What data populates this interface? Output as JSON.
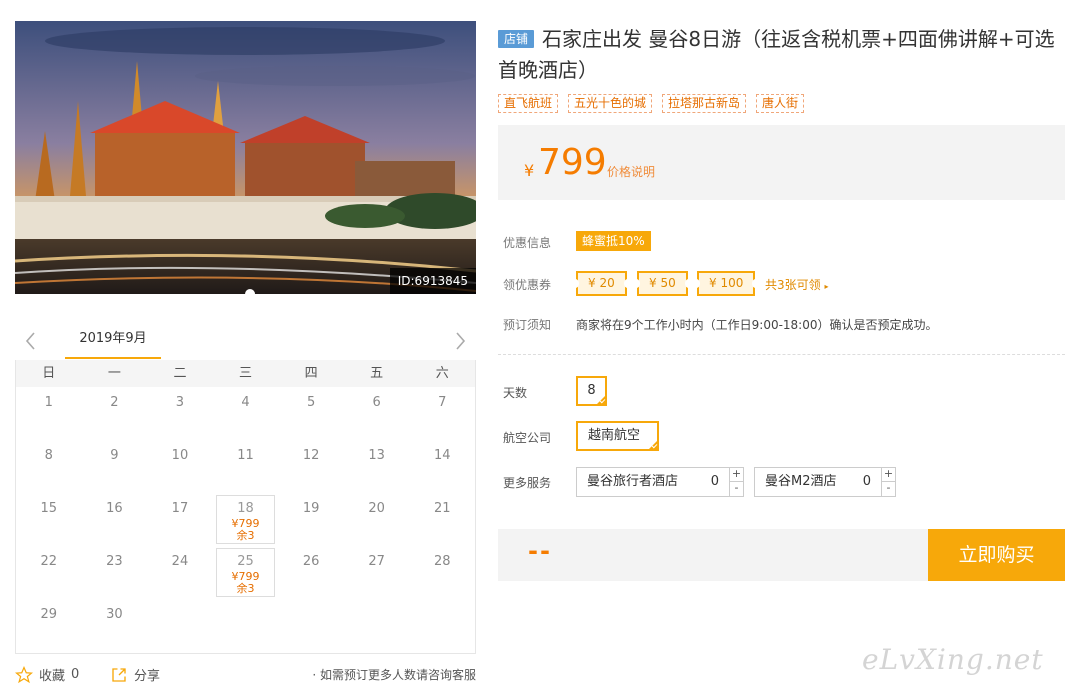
{
  "hero": {
    "image_id": "ID:6913845"
  },
  "calendar": {
    "month": "2019年9月",
    "weekdays": [
      "日",
      "一",
      "二",
      "三",
      "四",
      "五",
      "六"
    ],
    "rows": [
      [
        {
          "day": "1"
        },
        {
          "day": "2"
        },
        {
          "day": "3"
        },
        {
          "day": "4"
        },
        {
          "day": "5"
        },
        {
          "day": "6"
        },
        {
          "day": "7"
        }
      ],
      [
        {
          "day": "8"
        },
        {
          "day": "9"
        },
        {
          "day": "10"
        },
        {
          "day": "11"
        },
        {
          "day": "12"
        },
        {
          "day": "13"
        },
        {
          "day": "14"
        }
      ],
      [
        {
          "day": "15"
        },
        {
          "day": "16"
        },
        {
          "day": "17"
        },
        {
          "day": "18",
          "price": "¥799",
          "left": "余3"
        },
        {
          "day": "19"
        },
        {
          "day": "20"
        },
        {
          "day": "21"
        }
      ],
      [
        {
          "day": "22"
        },
        {
          "day": "23"
        },
        {
          "day": "24"
        },
        {
          "day": "25",
          "price": "¥799",
          "left": "余3"
        },
        {
          "day": "26"
        },
        {
          "day": "27"
        },
        {
          "day": "28"
        }
      ],
      [
        {
          "day": "29"
        },
        {
          "day": "30"
        },
        {
          "day": ""
        },
        {
          "day": ""
        },
        {
          "day": ""
        },
        {
          "day": ""
        },
        {
          "day": ""
        }
      ]
    ]
  },
  "bottom": {
    "favorite_label": "收藏",
    "favorite_count": "0",
    "share_label": "分享",
    "consult_text": "如需预订更多人数请咨询客服"
  },
  "product": {
    "shop_badge": "店铺",
    "title": "石家庄出发 曼谷8日游（往返含税机票+四面佛讲解+可选首晚酒店）",
    "tags": [
      "直飞航班",
      "五光十色的城",
      "拉塔那古新岛",
      "唐人街"
    ],
    "price_symbol": "¥",
    "price": "799",
    "price_note": "价格说明"
  },
  "info": {
    "discount_label": "优惠信息",
    "discount_value": "蜂蜜抵10%",
    "coupon_label": "领优惠券",
    "coupons": [
      "¥ 20",
      "¥ 50",
      "¥ 100"
    ],
    "coupon_more": "共3张可领",
    "notice_label": "预订须知",
    "notice_text": "商家将在9个工作小时内（工作日9:00-18:00）确认是否预定成功。"
  },
  "options": {
    "days_label": "天数",
    "days_value": "8",
    "airline_label": "航空公司",
    "airline_value": "越南航空",
    "services_label": "更多服务",
    "services": [
      {
        "name": "曼谷旅行者酒店",
        "qty": "0"
      },
      {
        "name": "曼谷M2酒店",
        "qty": "0"
      }
    ],
    "plus": "+",
    "minus": "-"
  },
  "purchase": {
    "total": "--",
    "buy_label": "立即购买"
  },
  "watermark": "eLvXing.net",
  "colors": {
    "accent": "#f7a80a",
    "price": "#f57c00",
    "badge": "#5a9bd6"
  }
}
